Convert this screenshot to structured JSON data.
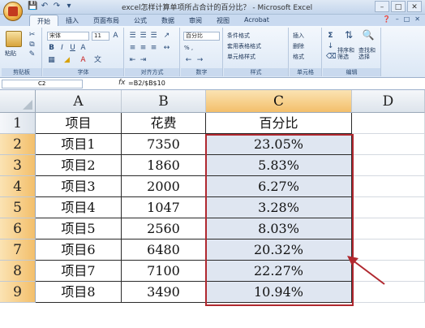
{
  "window": {
    "title": "excel怎样计算单项所占合计的百分比？ - Microsoft Excel"
  },
  "ribbon": {
    "tabs": [
      "开始",
      "插入",
      "页面布局",
      "公式",
      "数据",
      "审阅",
      "视图",
      "Acrobat"
    ],
    "active_tab": "开始",
    "paste_label": "粘贴",
    "font_name": "宋体",
    "font_size": "11",
    "number_format": "百分比",
    "percent_btn": "% ,",
    "groups": [
      "剪贴板",
      "字体",
      "对齐方式",
      "数字",
      "样式",
      "单元格",
      "编辑"
    ],
    "styles": [
      "条件格式",
      "套用表格格式",
      "单元格样式"
    ],
    "cells": [
      "插入",
      "删除",
      "格式"
    ],
    "editing": [
      "排序和\n筛选",
      "查找和\n选择"
    ],
    "accent_color": "#b0282f"
  },
  "formula_bar": {
    "name_box": "C2",
    "fx": "fx",
    "formula": "=B2/$B$10"
  },
  "sheet": {
    "columns": [
      "A",
      "B",
      "C",
      "D"
    ],
    "selected_column": "C",
    "rows": [
      {
        "num": "1",
        "a": "项目",
        "b": "花费",
        "c": "百分比"
      },
      {
        "num": "2",
        "a": "项目1",
        "b": "7350",
        "c": "23.05%"
      },
      {
        "num": "3",
        "a": "项目2",
        "b": "1860",
        "c": "5.83%"
      },
      {
        "num": "4",
        "a": "项目3",
        "b": "2000",
        "c": "6.27%"
      },
      {
        "num": "5",
        "a": "项目4",
        "b": "1047",
        "c": "3.28%"
      },
      {
        "num": "6",
        "a": "项目5",
        "b": "2560",
        "c": "8.03%"
      },
      {
        "num": "7",
        "a": "项目6",
        "b": "6480",
        "c": "20.32%"
      },
      {
        "num": "8",
        "a": "项目7",
        "b": "7100",
        "c": "22.27%"
      },
      {
        "num": "9",
        "a": "项目8",
        "b": "3490",
        "c": "10.94%"
      }
    ]
  }
}
